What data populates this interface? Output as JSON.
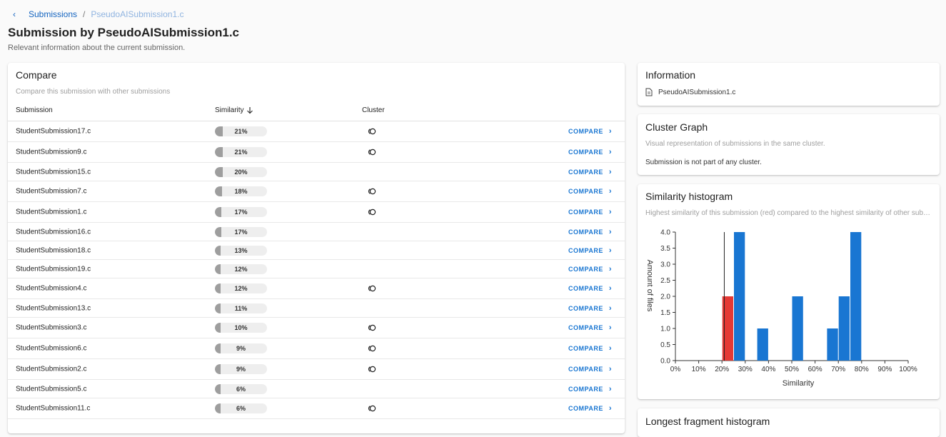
{
  "breadcrumb": {
    "back_icon": "chevron-left-icon",
    "parent": "Submissions",
    "separator": "/",
    "current": "PseudoAISubmission1.c"
  },
  "page": {
    "title": "Submission by PseudoAISubmission1.c",
    "subtitle": "Relevant information about the current submission."
  },
  "compare": {
    "title": "Compare",
    "subtitle": "Compare this submission with other submissions",
    "columns": {
      "submission": "Submission",
      "similarity": "Similarity",
      "cluster": "Cluster"
    },
    "sort_icon": "arrow-down-icon",
    "compare_label": "COMPARE",
    "rows": [
      {
        "name": "StudentSubmission17.c",
        "similarity": 21,
        "label": "21%",
        "cluster": true
      },
      {
        "name": "StudentSubmission9.c",
        "similarity": 21,
        "label": "21%",
        "cluster": true
      },
      {
        "name": "StudentSubmission15.c",
        "similarity": 20,
        "label": "20%",
        "cluster": false
      },
      {
        "name": "StudentSubmission7.c",
        "similarity": 18,
        "label": "18%",
        "cluster": true
      },
      {
        "name": "StudentSubmission1.c",
        "similarity": 17,
        "label": "17%",
        "cluster": true
      },
      {
        "name": "StudentSubmission16.c",
        "similarity": 17,
        "label": "17%",
        "cluster": false
      },
      {
        "name": "StudentSubmission18.c",
        "similarity": 13,
        "label": "13%",
        "cluster": false
      },
      {
        "name": "StudentSubmission19.c",
        "similarity": 12,
        "label": "12%",
        "cluster": false
      },
      {
        "name": "StudentSubmission4.c",
        "similarity": 12,
        "label": "12%",
        "cluster": true
      },
      {
        "name": "StudentSubmission13.c",
        "similarity": 11,
        "label": "11%",
        "cluster": false
      },
      {
        "name": "StudentSubmission3.c",
        "similarity": 10,
        "label": "10%",
        "cluster": true
      },
      {
        "name": "StudentSubmission6.c",
        "similarity": 9,
        "label": "9%",
        "cluster": true
      },
      {
        "name": "StudentSubmission2.c",
        "similarity": 9,
        "label": "9%",
        "cluster": true
      },
      {
        "name": "StudentSubmission5.c",
        "similarity": 6,
        "label": "6%",
        "cluster": false
      },
      {
        "name": "StudentSubmission11.c",
        "similarity": 6,
        "label": "6%",
        "cluster": true
      }
    ]
  },
  "information": {
    "title": "Information",
    "file_icon": "file-icon",
    "file": "PseudoAISubmission1.c"
  },
  "cluster_graph": {
    "title": "Cluster Graph",
    "subtitle": "Visual representation of submissions in the same cluster.",
    "note": "Submission is not part of any cluster."
  },
  "histogram": {
    "title": "Similarity histogram",
    "subtitle": "Highest similarity of this submission (red) compared to the highest similarity of other submissions"
  },
  "longest_fragment": {
    "title": "Longest fragment histogram"
  },
  "colors": {
    "accent": "#1976d2",
    "highlight": "#e53935",
    "bar": "#1976d2"
  },
  "chart_data": {
    "type": "bar",
    "xlabel": "Similarity",
    "ylabel": "Amount of files",
    "x_ticks": [
      "0%",
      "10%",
      "20%",
      "30%",
      "40%",
      "50%",
      "60%",
      "70%",
      "80%",
      "90%",
      "100%"
    ],
    "y_ticks": [
      "0.0",
      "0.5",
      "1.0",
      "1.5",
      "2.0",
      "2.5",
      "3.0",
      "3.5",
      "4.0"
    ],
    "ylim": [
      0,
      4
    ],
    "xlim": [
      0,
      100
    ],
    "marker_x": 21,
    "bins": [
      {
        "x0": 20,
        "x1": 25,
        "value": 2,
        "highlight": true
      },
      {
        "x0": 25,
        "x1": 30,
        "value": 4,
        "highlight": false
      },
      {
        "x0": 35,
        "x1": 40,
        "value": 1,
        "highlight": false
      },
      {
        "x0": 50,
        "x1": 55,
        "value": 2,
        "highlight": false
      },
      {
        "x0": 65,
        "x1": 70,
        "value": 1,
        "highlight": false
      },
      {
        "x0": 70,
        "x1": 75,
        "value": 2,
        "highlight": false
      },
      {
        "x0": 75,
        "x1": 80,
        "value": 4,
        "highlight": false
      }
    ]
  }
}
